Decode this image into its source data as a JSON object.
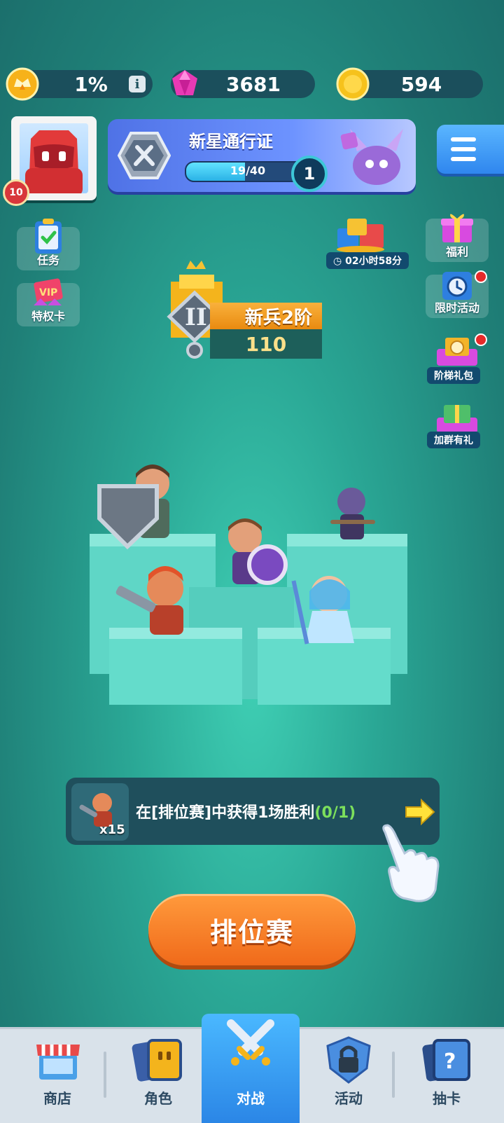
{
  "top_bar": {
    "progress_percent": "1%",
    "gems": "3681",
    "coins": "594"
  },
  "player": {
    "level": "10"
  },
  "pass": {
    "title": "新星通行证",
    "progress_text": "19/40",
    "progress_fraction": 0.475,
    "pass_level": "1"
  },
  "side_left": {
    "task_label": "任务",
    "privilege_label": "特权卡"
  },
  "side_right": {
    "timer_label": "02小时58分",
    "welfare_label": "福利",
    "limited_event_label": "限时活动",
    "ladder_pack_label": "阶梯礼包",
    "group_gift_label": "加群有礼"
  },
  "rank": {
    "name": "新兵2阶",
    "score": "110"
  },
  "quest": {
    "text": "在[排位赛]中获得1场胜利",
    "progress": "(0/1)",
    "reward_count": "x15"
  },
  "main_button": {
    "label": "排位赛"
  },
  "nav": {
    "shop": "商店",
    "hero": "角色",
    "battle": "对战",
    "event": "活动",
    "draw": "抽卡"
  },
  "colors": {
    "background": "#2aa795",
    "accent_orange": "#f06a1a",
    "nav_active": "#2b86e6"
  }
}
